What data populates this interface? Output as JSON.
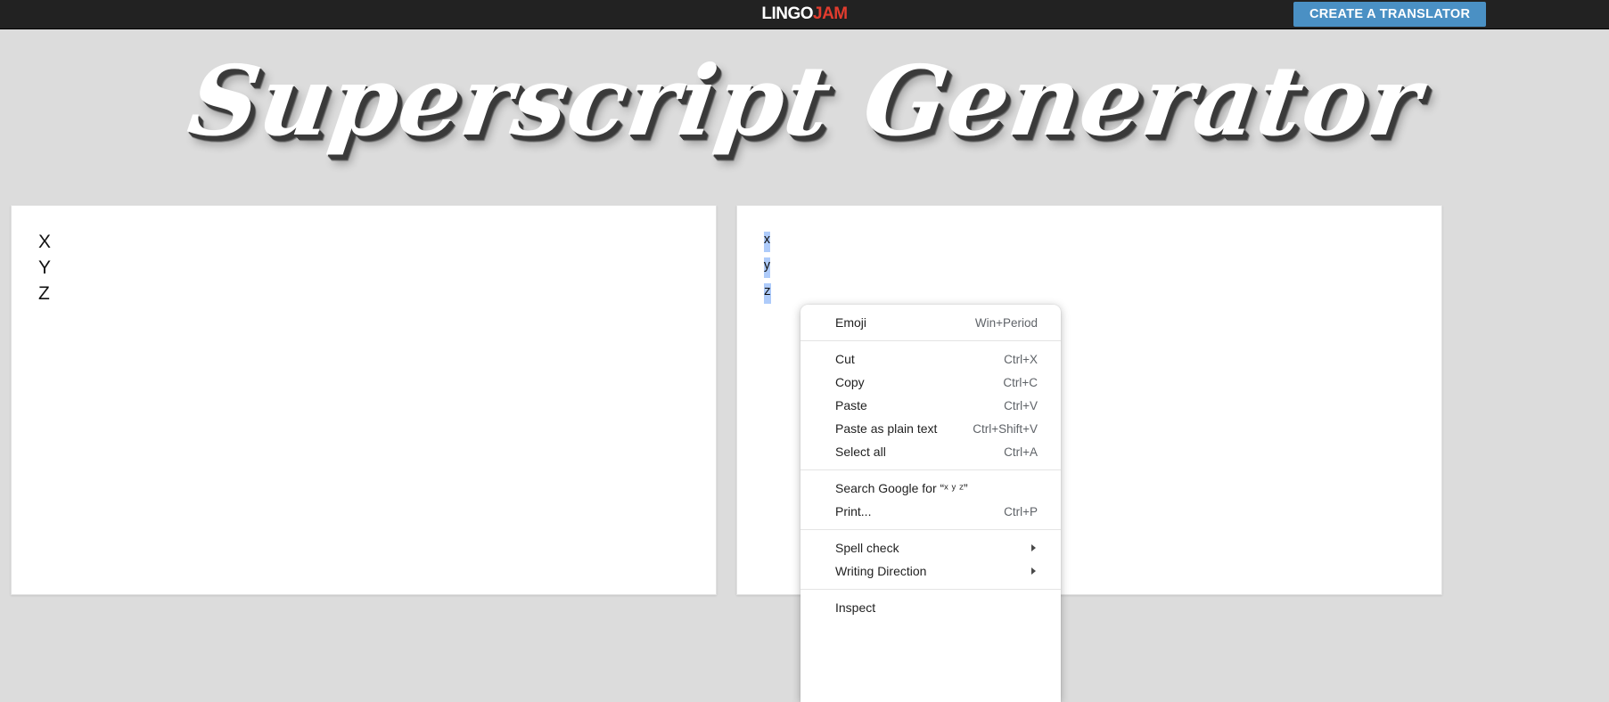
{
  "topbar": {
    "logo_part1": "LINGO",
    "logo_part2": "JAM",
    "create_button": "CREATE A TRANSLATOR"
  },
  "hero": {
    "title": "Superscript Generator"
  },
  "panels": {
    "input": {
      "value": "X\nY\nZ"
    },
    "output": {
      "value": "ˣ\nʸ\nᶻ",
      "selection_color": "#aecbfa"
    }
  },
  "context_menu": {
    "items": [
      {
        "label": "Emoji",
        "accel": "Win+Period",
        "submenu": false
      },
      {
        "label": "Cut",
        "accel": "Ctrl+X",
        "submenu": false
      },
      {
        "label": "Copy",
        "accel": "Ctrl+C",
        "submenu": false
      },
      {
        "label": "Paste",
        "accel": "Ctrl+V",
        "submenu": false
      },
      {
        "label": "Paste as plain text",
        "accel": "Ctrl+Shift+V",
        "submenu": false
      },
      {
        "label": "Select all",
        "accel": "Ctrl+A",
        "submenu": false
      },
      {
        "label": "Search Google for “ˣ ʸ ᶻ”",
        "accel": "",
        "submenu": false
      },
      {
        "label": "Print...",
        "accel": "Ctrl+P",
        "submenu": false
      },
      {
        "label": "Spell check",
        "accel": "",
        "submenu": true
      },
      {
        "label": "Writing Direction",
        "accel": "",
        "submenu": true
      },
      {
        "label": "Inspect",
        "accel": "",
        "submenu": false
      }
    ]
  },
  "colors": {
    "topbar_bg": "#222222",
    "page_bg": "#dcdcdc",
    "accent_blue": "#4a90c4",
    "logo_red": "#e23c2e"
  }
}
